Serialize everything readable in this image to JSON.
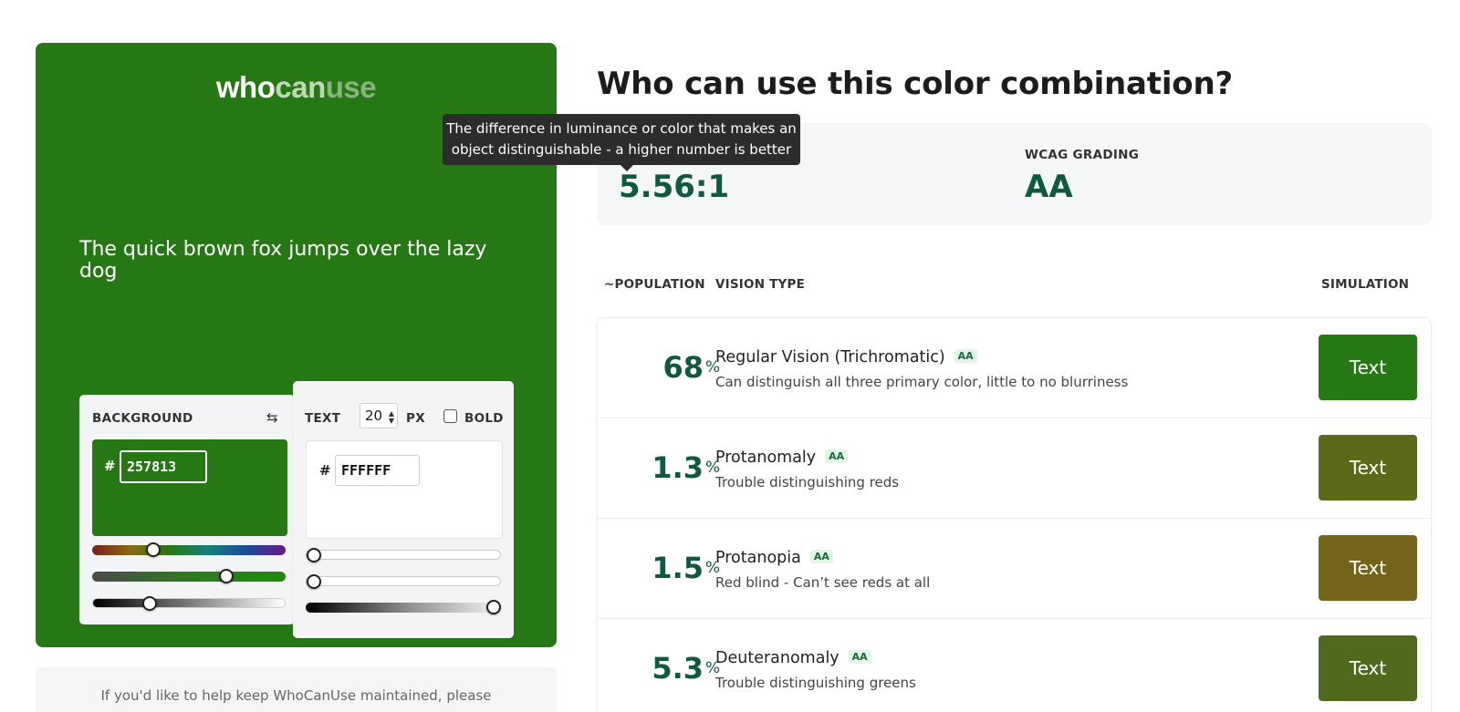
{
  "preview": {
    "logo": {
      "part1": "who",
      "part2": "can",
      "part3": "use"
    },
    "sample_text": "The quick brown fox jumps over the lazy dog",
    "background_color": "#257813"
  },
  "controls": {
    "background": {
      "label": "BACKGROUND",
      "hash": "#",
      "hex_value": "257813",
      "hue_level": 0.3,
      "saturation_level": 0.71,
      "lightness_level": 0.28
    },
    "text": {
      "label": "TEXT",
      "size": "20",
      "size_unit": "PX",
      "bold_label": "BOLD",
      "bold_checked": false,
      "hash": "#",
      "hex_value": "FFFFFF",
      "hue_level": 0.0,
      "saturation_level": 0.0,
      "lightness_level": 1.0
    }
  },
  "support_text": "If you'd like to help keep WhoCanUse maintained, please",
  "title": "Who can use this color combination?",
  "stats": {
    "grading_label": "WCAG GRADING",
    "contrast_value": "5.56:1",
    "grading_value": "AA",
    "tooltip": "The difference in luminance or color that makes an object distinguishable - a higher number is better"
  },
  "columns": {
    "population": "~POPULATION",
    "vision_type": "VISION TYPE",
    "simulation": "SIMULATION"
  },
  "rows": [
    {
      "pct": "68",
      "name": "Regular Vision (Trichromatic)",
      "badge": "AA",
      "desc": "Can distinguish all three primary color, little to no blurriness",
      "sim_label": "Text",
      "sim_color": "#257813"
    },
    {
      "pct": "1.3",
      "name": "Protanomaly",
      "badge": "AA",
      "desc": "Trouble distinguishing reds",
      "sim_label": "Text",
      "sim_color": "#5a6a18"
    },
    {
      "pct": "1.5",
      "name": "Protanopia",
      "badge": "AA",
      "desc": "Red blind - Can’t see reds at all",
      "sim_label": "Text",
      "sim_color": "#74641a"
    },
    {
      "pct": "5.3",
      "name": "Deuteranomaly",
      "badge": "AA",
      "desc": "Trouble distinguishing greens",
      "sim_label": "Text",
      "sim_color": "#4f6a1c"
    }
  ],
  "pct_sign": "%",
  "colors": {
    "accent": "#0f5a3e",
    "background": "#257813",
    "text": "#FFFFFF"
  },
  "icons": {
    "swap": "swap-arrows-icon",
    "spinner": "spinner-arrows-icon"
  }
}
